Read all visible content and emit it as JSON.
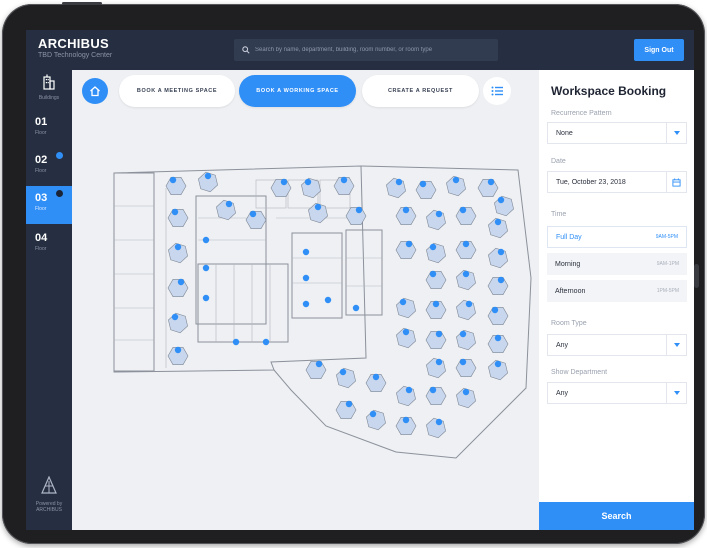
{
  "header": {
    "brand_title": "ARCHIBUS",
    "brand_subtitle": "TBD Technology Center",
    "search_placeholder": "Search by name, department, building, room number, or room type",
    "signout_label": "Sign Out"
  },
  "sidebar": {
    "buildings_label": "Buildings",
    "floors": [
      {
        "num": "01",
        "label": "Floor",
        "active": false,
        "badge": false
      },
      {
        "num": "02",
        "label": "Floor",
        "active": false,
        "badge": true
      },
      {
        "num": "03",
        "label": "Floor",
        "active": true,
        "badge": true
      },
      {
        "num": "04",
        "label": "Floor",
        "active": false,
        "badge": false
      }
    ],
    "powered_by": "Powered by ARCHIBUS"
  },
  "tabs": [
    {
      "label": "BOOK A MEETING SPACE",
      "active": false
    },
    {
      "label": "BOOK A WORKING SPACE",
      "active": true
    },
    {
      "label": "CREATE A REQUEST",
      "active": false
    }
  ],
  "panel": {
    "title": "Workspace Booking",
    "recurrence_label": "Recurrence Pattern",
    "recurrence_value": "None",
    "date_label": "Date",
    "date_value": "Tue, October 23, 2018",
    "time_label": "Time",
    "time_options": [
      {
        "label": "Full Day",
        "range": "9AM-5PM",
        "active": true
      },
      {
        "label": "Morning",
        "range": "9AM-1PM",
        "active": false
      },
      {
        "label": "Afternoon",
        "range": "1PM-5PM",
        "active": false
      }
    ],
    "room_type_label": "Room Type",
    "room_type_value": "Any",
    "department_label": "Show Department",
    "department_value": "Any",
    "search_label": "Search"
  },
  "colors": {
    "accent": "#2f8ff7",
    "header_bg": "#262f41",
    "canvas_bg": "#eef0f3"
  }
}
